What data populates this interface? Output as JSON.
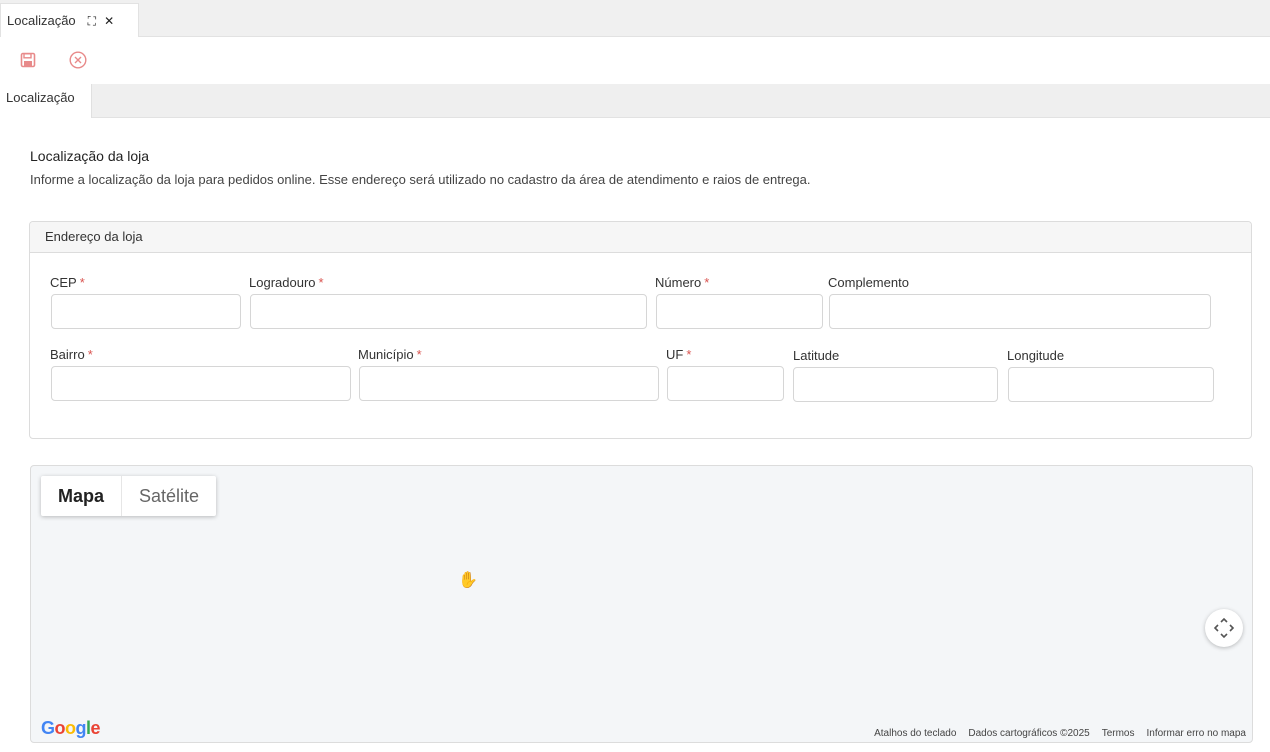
{
  "window": {
    "tab_label": "Localização",
    "expand_icon": "⛶",
    "close_icon": "✕"
  },
  "toolbar": {
    "save_icon": "save-icon",
    "cancel_icon": "cancel-circle-icon",
    "icon_color": "#e88a8a"
  },
  "subtabs": [
    "Localização"
  ],
  "section": {
    "title": "Localização da loja",
    "description": "Informe a localização da loja para pedidos online. Esse endereço será utilizado no cadastro da área de atendimento e raios de entrega."
  },
  "address_panel": {
    "header": "Endereço da loja",
    "fields": {
      "cep": {
        "label": "CEP",
        "required": "*",
        "value": ""
      },
      "logradouro": {
        "label": "Logradouro",
        "required": "*",
        "value": ""
      },
      "numero": {
        "label": "Número",
        "required": "*",
        "value": ""
      },
      "complemento": {
        "label": "Complemento",
        "value": ""
      },
      "bairro": {
        "label": "Bairro",
        "required": "*",
        "value": ""
      },
      "municipio": {
        "label": "Município",
        "required": "*",
        "value": ""
      },
      "uf": {
        "label": "UF",
        "required": "*",
        "value": ""
      },
      "latitude": {
        "label": "Latitude",
        "value": ""
      },
      "longitude": {
        "label": "Longitude",
        "value": ""
      }
    }
  },
  "map": {
    "type_buttons": {
      "map": "Mapa",
      "satellite": "Satélite"
    },
    "selected_type": "Mapa",
    "logo": "Google",
    "footer": {
      "shortcuts": "Atalhos do teclado",
      "map_data": "Dados cartográficos ©2025",
      "terms": "Termos",
      "report_error": "Informar erro no mapa"
    }
  }
}
